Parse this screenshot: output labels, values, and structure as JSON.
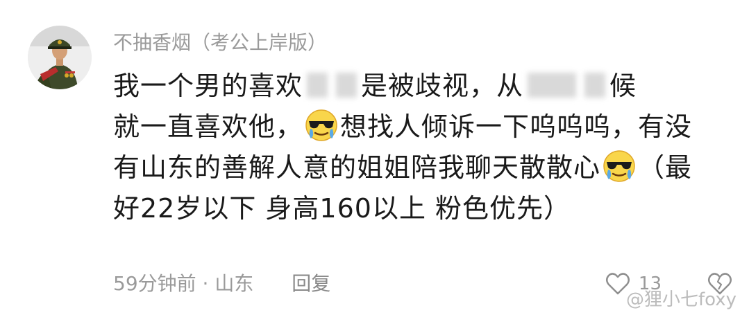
{
  "comment": {
    "username": "不抽香烟（考公上岸版）",
    "lines": [
      {
        "segments": [
          "我一个男的喜欢",
          "是被歧视，从",
          "候"
        ]
      },
      {
        "before": "就一直喜欢他，",
        "after": "想找人倾诉一下呜呜呜，有没"
      },
      {
        "before": "有山东的善解人意的姐姐陪我聊天散散心",
        "after": "（最"
      },
      {
        "text": "好22岁以下  身高160以上 粉色优先）"
      }
    ],
    "emoji_name": "sunglasses-crying-emoji",
    "time": "59分钟前",
    "separator": "·",
    "location": "山东",
    "reply_label": "回复",
    "like_count": "13"
  },
  "watermark": "@狸小七foxy",
  "icons": {
    "like": "heart-outline-icon",
    "dislike": "heart-broken-icon"
  },
  "colors": {
    "text": "#1a1a1a",
    "muted": "#9a9a9a",
    "background": "#ffffff"
  }
}
